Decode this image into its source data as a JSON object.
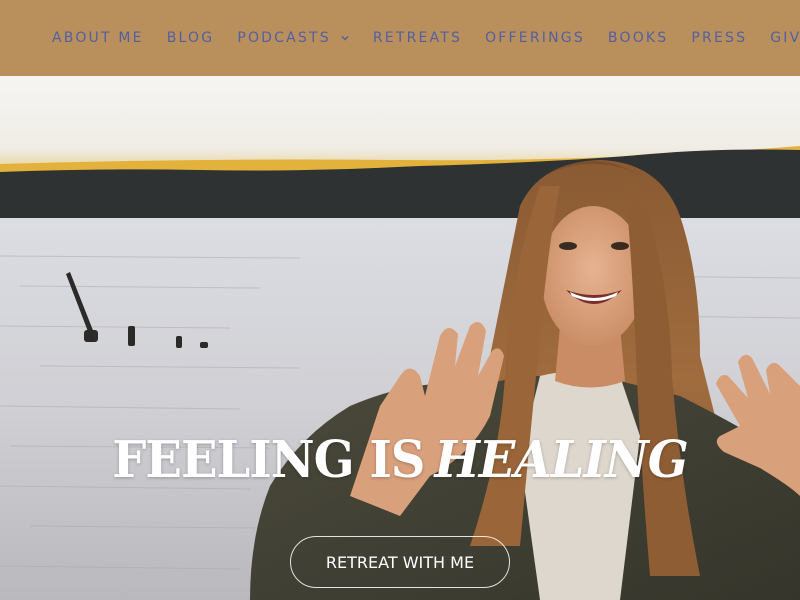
{
  "nav": {
    "items": [
      {
        "label": "ABOUT ME"
      },
      {
        "label": "BLOG"
      },
      {
        "label": "PODCASTS",
        "has_dropdown": true
      },
      {
        "label": "RETREATS"
      },
      {
        "label": "OFFERINGS"
      },
      {
        "label": "BOOKS"
      },
      {
        "label": "PRESS"
      },
      {
        "label": "GIVE BA"
      }
    ]
  },
  "hero": {
    "title_part1": "FEELING IS",
    "title_part2": "HEALING",
    "cta_label": "RETREAT WITH ME"
  },
  "colors": {
    "nav_background": "#b98f5c",
    "nav_text": "#5260a3",
    "hero_text": "#ffffff"
  }
}
